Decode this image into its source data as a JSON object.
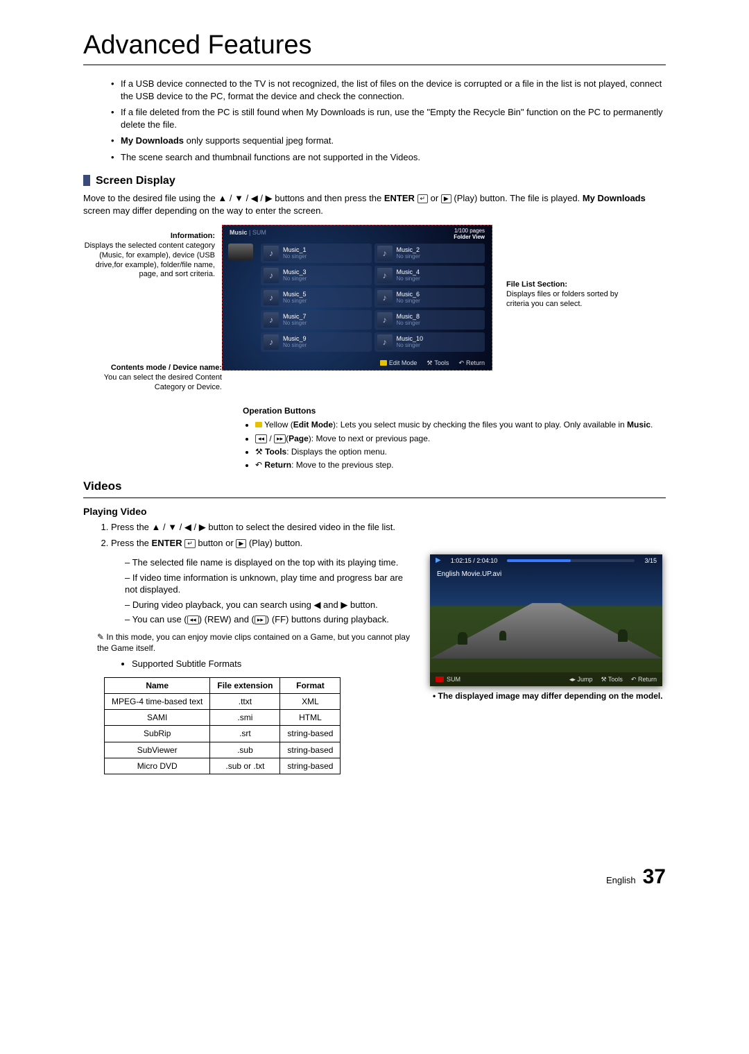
{
  "page": {
    "title": "Advanced Features",
    "tips": [
      "If a USB device connected to the TV is not recognized, the list of files on the device is corrupted or a file in the list is not played, connect the USB device to the PC, format the device and check the connection.",
      "If a file deleted from the PC is still found when My Downloads is run, use the \"Empty the Recycle Bin\" function on the PC to permanently delete the file.",
      "My Downloads only supports sequential jpeg format.",
      "The scene search and thumbnail functions are not supported in the Videos."
    ],
    "screen_display_heading": "Screen Display",
    "screen_display_para": "Move to the desired file using the ▲ / ▼ / ◀ / ▶ buttons and then press the ENTER or (Play) button. The file is played. My Downloads screen may differ depending on the way to enter the screen.",
    "annotations": {
      "information": {
        "title": "Information:",
        "text": "Displays the selected content category (Music, for example), device (USB drive,for example), folder/file name, page, and sort criteria."
      },
      "contents": {
        "title": "Contents mode / Device name:",
        "text": "You can select the desired Content Category or Device."
      },
      "filelist": {
        "title": "File List Section:",
        "text": "Displays files or folders sorted by criteria you can select."
      }
    },
    "music_screen": {
      "category": "Music",
      "sub": "| SUM",
      "page_info": "1/100 pages",
      "folder_view": "Folder View",
      "no_singer": "No singer",
      "files": [
        "Music_1",
        "Music_2",
        "Music_3",
        "Music_4",
        "Music_5",
        "Music_6",
        "Music_7",
        "Music_8",
        "Music_9",
        "Music_10"
      ],
      "footer": {
        "edit": "Edit Mode",
        "tools": "Tools",
        "return": "Return"
      }
    },
    "operation": {
      "title": "Operation Buttons",
      "items": {
        "yellow": "Yellow (Edit Mode): Lets you select music by checking the files you want to play. Only available in Music.",
        "page": "(Page): Move to next or previous page.",
        "tools": "Tools: Displays the option menu.",
        "return": "Return: Move to the previous step."
      }
    },
    "videos": {
      "heading": "Videos",
      "playing_heading": "Playing Video",
      "steps": [
        "Press the ▲ / ▼ / ◀ / ▶ button to select the desired video in the file list.",
        "Press the ENTER button or (Play) button."
      ],
      "sub": [
        "The selected file name is displayed on the top with its playing time.",
        "If video time information is unknown, play time and progress bar are not displayed.",
        "During video playback, you can search using ◀ and ▶ button.",
        "You can use (REW) and (FF) buttons during playback."
      ],
      "note": "In this mode, you can enjoy movie clips contained on a Game, but you cannot play the Game itself.",
      "supported_heading": "Supported Subtitle Formats",
      "table": {
        "headers": [
          "Name",
          "File extension",
          "Format"
        ],
        "rows": [
          [
            "MPEG-4 time-based text",
            ".ttxt",
            "XML"
          ],
          [
            "SAMI",
            ".smi",
            "HTML"
          ],
          [
            "SubRip",
            ".srt",
            "string-based"
          ],
          [
            "SubViewer",
            ".sub",
            "string-based"
          ],
          [
            "Micro DVD",
            ".sub or .txt",
            "string-based"
          ]
        ]
      },
      "player": {
        "time": "1:02:15 / 2:04:10",
        "count": "3/15",
        "filename": "English Movie.UP.avi",
        "footer_sum": "SUM",
        "footer_jump": "Jump",
        "footer_tools": "Tools",
        "footer_return": "Return"
      },
      "model_note": "The displayed image may differ depending on the model."
    },
    "footer": {
      "lang": "English",
      "page_num": "37"
    }
  }
}
